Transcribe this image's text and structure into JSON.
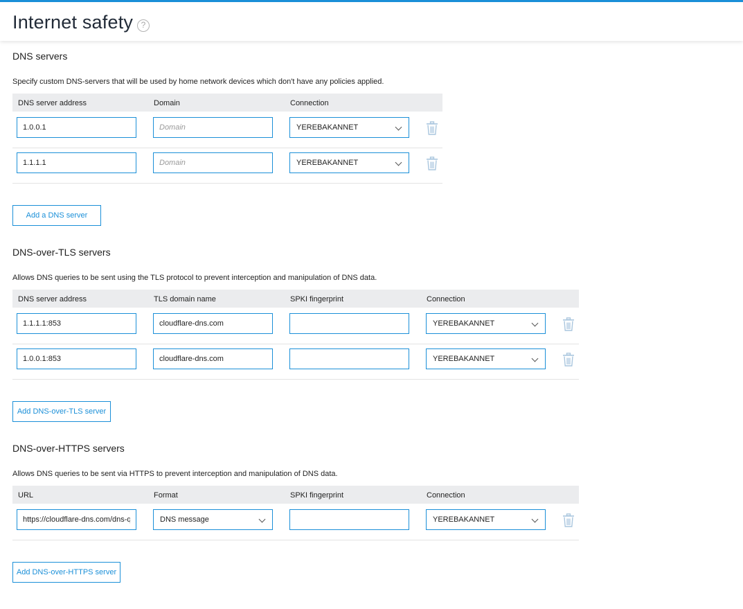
{
  "page": {
    "title": "Internet safety",
    "help_glyph": "?"
  },
  "dns": {
    "title": "DNS servers",
    "description": "Specify custom DNS-servers that will be used by home network devices which don't have any policies applied.",
    "columns": [
      "DNS server address",
      "Domain",
      "Connection"
    ],
    "rows": [
      {
        "address": "1.0.0.1",
        "domain": "",
        "domain_placeholder": "Domain",
        "connection": "YEREBAKANNET"
      },
      {
        "address": "1.1.1.1",
        "domain": "",
        "domain_placeholder": "Domain",
        "connection": "YEREBAKANNET"
      }
    ],
    "add_label": "Add a DNS server"
  },
  "dot": {
    "title": "DNS-over-TLS servers",
    "description": "Allows DNS queries to be sent using the TLS protocol to prevent interception and manipulation of DNS data.",
    "columns": [
      "DNS server address",
      "TLS domain name",
      "SPKI fingerprint",
      "Connection"
    ],
    "rows": [
      {
        "address": "1.1.1.1:853",
        "tls_domain": "cloudflare-dns.com",
        "spki": "",
        "connection": "YEREBAKANNET"
      },
      {
        "address": "1.0.0.1:853",
        "tls_domain": "cloudflare-dns.com",
        "spki": "",
        "connection": "YEREBAKANNET"
      }
    ],
    "add_label": "Add DNS-over-TLS server"
  },
  "doh": {
    "title": "DNS-over-HTTPS servers",
    "description": "Allows DNS queries to be sent via HTTPS to prevent interception and manipulation of DNS data.",
    "columns": [
      "URL",
      "Format",
      "SPKI fingerprint",
      "Connection"
    ],
    "rows": [
      {
        "url": "https://cloudflare-dns.com/dns-query",
        "format": "DNS message",
        "spki": "",
        "connection": "YEREBAKANNET"
      }
    ],
    "add_label": "Add DNS-over-HTTPS server"
  },
  "colors": {
    "accent": "#1a8fd8",
    "header_bg": "#ebecee",
    "trash": "#a9c6de"
  },
  "icons": {
    "help": "help-circle-icon",
    "trash": "trash-icon",
    "dropdown": "chevron-down-icon"
  }
}
